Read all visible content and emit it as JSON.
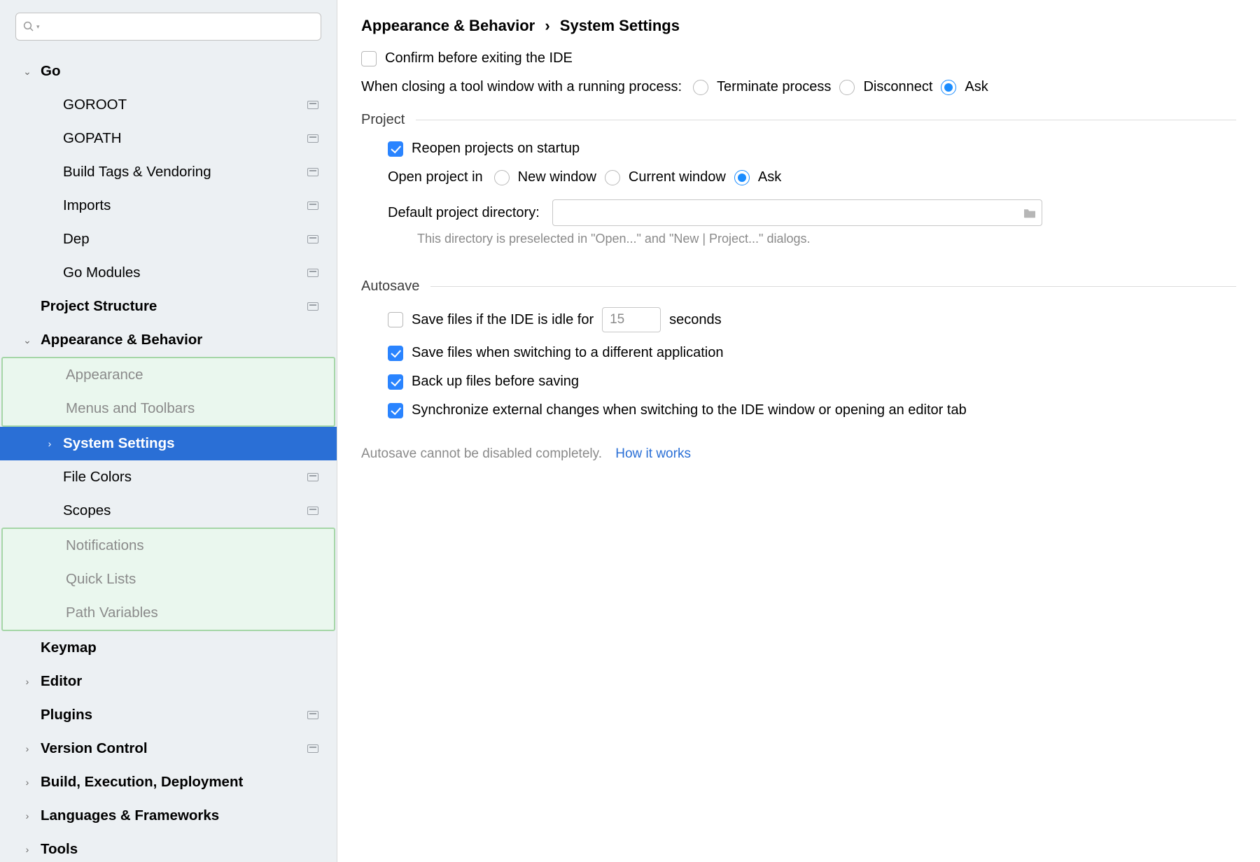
{
  "search": {
    "placeholder": ""
  },
  "tree": {
    "go": "Go",
    "go_children": {
      "goroot": "GOROOT",
      "gopath": "GOPATH",
      "build_tags": "Build Tags & Vendoring",
      "imports": "Imports",
      "dep": "Dep",
      "go_modules": "Go Modules"
    },
    "project_structure": "Project Structure",
    "appearance_behavior": "Appearance & Behavior",
    "ab_children": {
      "appearance": "Appearance",
      "menus_toolbars": "Menus and Toolbars",
      "system_settings": "System Settings",
      "file_colors": "File Colors",
      "scopes": "Scopes",
      "notifications": "Notifications",
      "quick_lists": "Quick Lists",
      "path_variables": "Path Variables"
    },
    "keymap": "Keymap",
    "editor": "Editor",
    "plugins": "Plugins",
    "version_control": "Version Control",
    "build_exec": "Build, Execution, Deployment",
    "lang_fw": "Languages & Frameworks",
    "tools": "Tools"
  },
  "crumb": {
    "a": "Appearance & Behavior",
    "sep": "›",
    "b": "System Settings"
  },
  "top": {
    "confirm_exit": "Confirm before exiting the IDE",
    "close_tool_label": "When closing a tool window with a running process:",
    "terminate": "Terminate process",
    "disconnect": "Disconnect",
    "ask": "Ask"
  },
  "project": {
    "section": "Project",
    "reopen": "Reopen projects on startup",
    "openin_label": "Open project in",
    "new_window": "New window",
    "current_window": "Current window",
    "ask": "Ask",
    "dir_label": "Default project directory:",
    "dir_value": "",
    "hint": "This directory is preselected in \"Open...\" and \"New | Project...\" dialogs."
  },
  "autosave": {
    "section": "Autosave",
    "idle_pre": "Save files if the IDE is idle for",
    "idle_value": "15",
    "idle_post": "seconds",
    "switch_app": "Save files when switching to a different application",
    "backup": "Back up files before saving",
    "sync": "Synchronize external changes when switching to the IDE window or opening an editor tab"
  },
  "footer": {
    "note": "Autosave cannot be disabled completely.",
    "link": "How it works"
  }
}
